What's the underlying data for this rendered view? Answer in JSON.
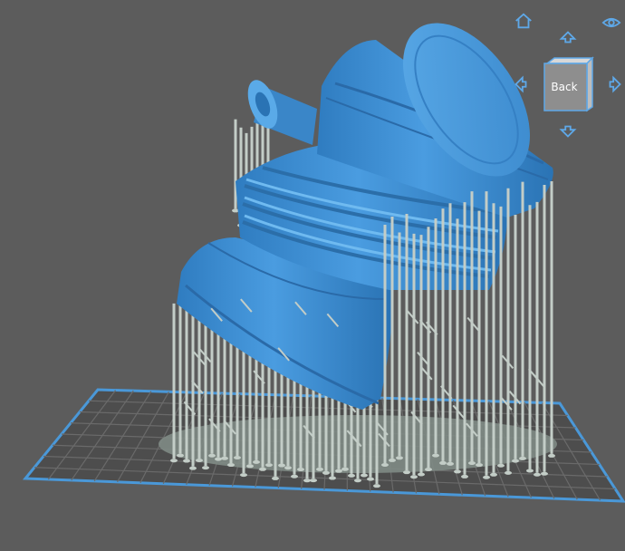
{
  "viewport": {
    "background_color": "#5c5c5c",
    "model_color": "#3f8fd2",
    "support_color": "#c3cdc7",
    "build_plate_color": "#4a98d8",
    "raft_color": "#7f8b85"
  },
  "view_controls": {
    "home_icon": "home-icon",
    "visibility_icon": "eye-icon",
    "rotate_up_icon": "arrow-up-icon",
    "rotate_down_icon": "arrow-down-icon",
    "rotate_left_icon": "arrow-left-icon",
    "rotate_right_icon": "arrow-right-icon",
    "cube_face_label": "Back",
    "accent_color": "#5ea8e8"
  }
}
